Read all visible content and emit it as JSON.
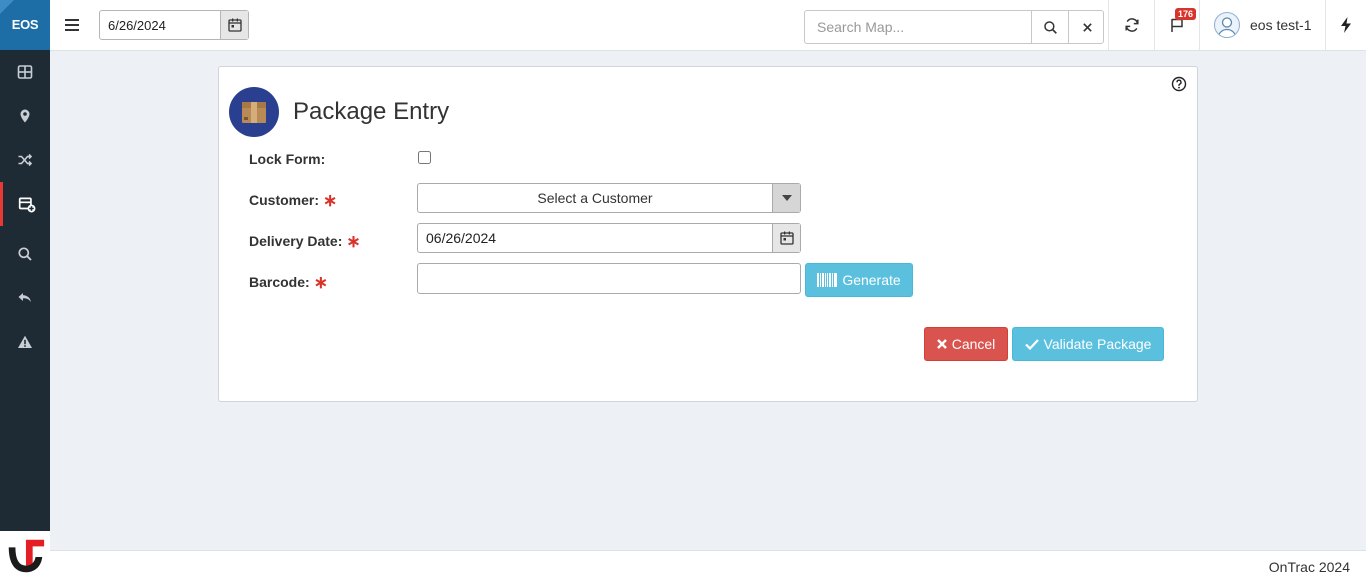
{
  "app": {
    "logo_text": "EOS"
  },
  "header": {
    "date_value": "6/26/2024",
    "search_placeholder": "Search Map...",
    "notification_count": "176",
    "user_name": "eos test-1"
  },
  "sidebar": {
    "items": [
      {
        "name": "dashboard",
        "icon": "grid-icon"
      },
      {
        "name": "map",
        "icon": "map-pin-icon"
      },
      {
        "name": "routes",
        "icon": "shuffle-icon"
      },
      {
        "name": "package-entry",
        "icon": "box-add-icon",
        "active": true
      },
      {
        "name": "search",
        "icon": "search-icon"
      },
      {
        "name": "returns",
        "icon": "reply-icon"
      },
      {
        "name": "alerts",
        "icon": "warning-icon"
      }
    ]
  },
  "form": {
    "title": "Package Entry",
    "lock_label": "Lock Form:",
    "customer_label": "Customer:",
    "customer_placeholder": "Select a Customer",
    "delivery_label": "Delivery Date:",
    "delivery_value": "06/26/2024",
    "barcode_label": "Barcode:",
    "barcode_value": "",
    "required_mark": "∗",
    "generate_label": "Generate",
    "cancel_label": "Cancel",
    "validate_label": "Validate Package"
  },
  "footer": {
    "text": "OnTrac 2024"
  },
  "colors": {
    "sidebar_bg": "#1f2b34",
    "logo_bg": "#1d6ea7",
    "active_accent": "#e53935",
    "info_button": "#5bc0de",
    "danger_button": "#d9534f",
    "badge": "#d9342b"
  }
}
